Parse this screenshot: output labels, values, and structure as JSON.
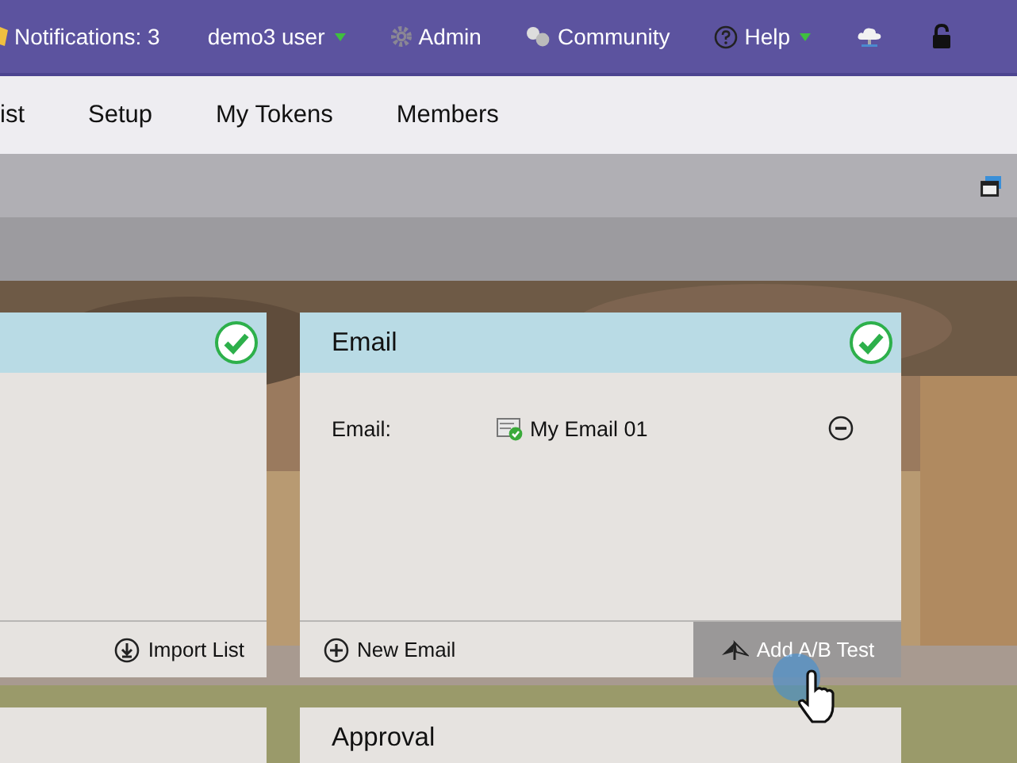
{
  "top_bar": {
    "items": [
      {
        "kind": "notifications",
        "label": "Notifications: 3",
        "dropdown": false
      },
      {
        "kind": "user",
        "label": "demo3 user",
        "dropdown": true
      },
      {
        "kind": "admin",
        "label": "Admin",
        "dropdown": false
      },
      {
        "kind": "community",
        "label": "Community",
        "dropdown": false
      },
      {
        "kind": "help",
        "label": "Help",
        "dropdown": true
      },
      {
        "kind": "cloud",
        "dropdown": false
      },
      {
        "kind": "lock",
        "dropdown": false
      }
    ]
  },
  "tabs": [
    {
      "label": "ist"
    },
    {
      "label": "Setup"
    },
    {
      "label": "My Tokens"
    },
    {
      "label": "Members"
    }
  ],
  "cards": [
    {
      "complete": true,
      "actions": [
        {
          "kind": "import",
          "label": "Import List",
          "hovered": false
        }
      ]
    },
    {
      "title": "Email",
      "complete": true,
      "rows": [
        {
          "label": "Email:",
          "value": "My Email 01"
        }
      ],
      "actions": [
        {
          "kind": "new",
          "label": "New Email",
          "hovered": false
        },
        {
          "kind": "ab",
          "label": "Add A/B Test",
          "hovered": true
        }
      ]
    },
    {
      "complete": false
    },
    {
      "title": "Approval",
      "complete": false
    }
  ]
}
